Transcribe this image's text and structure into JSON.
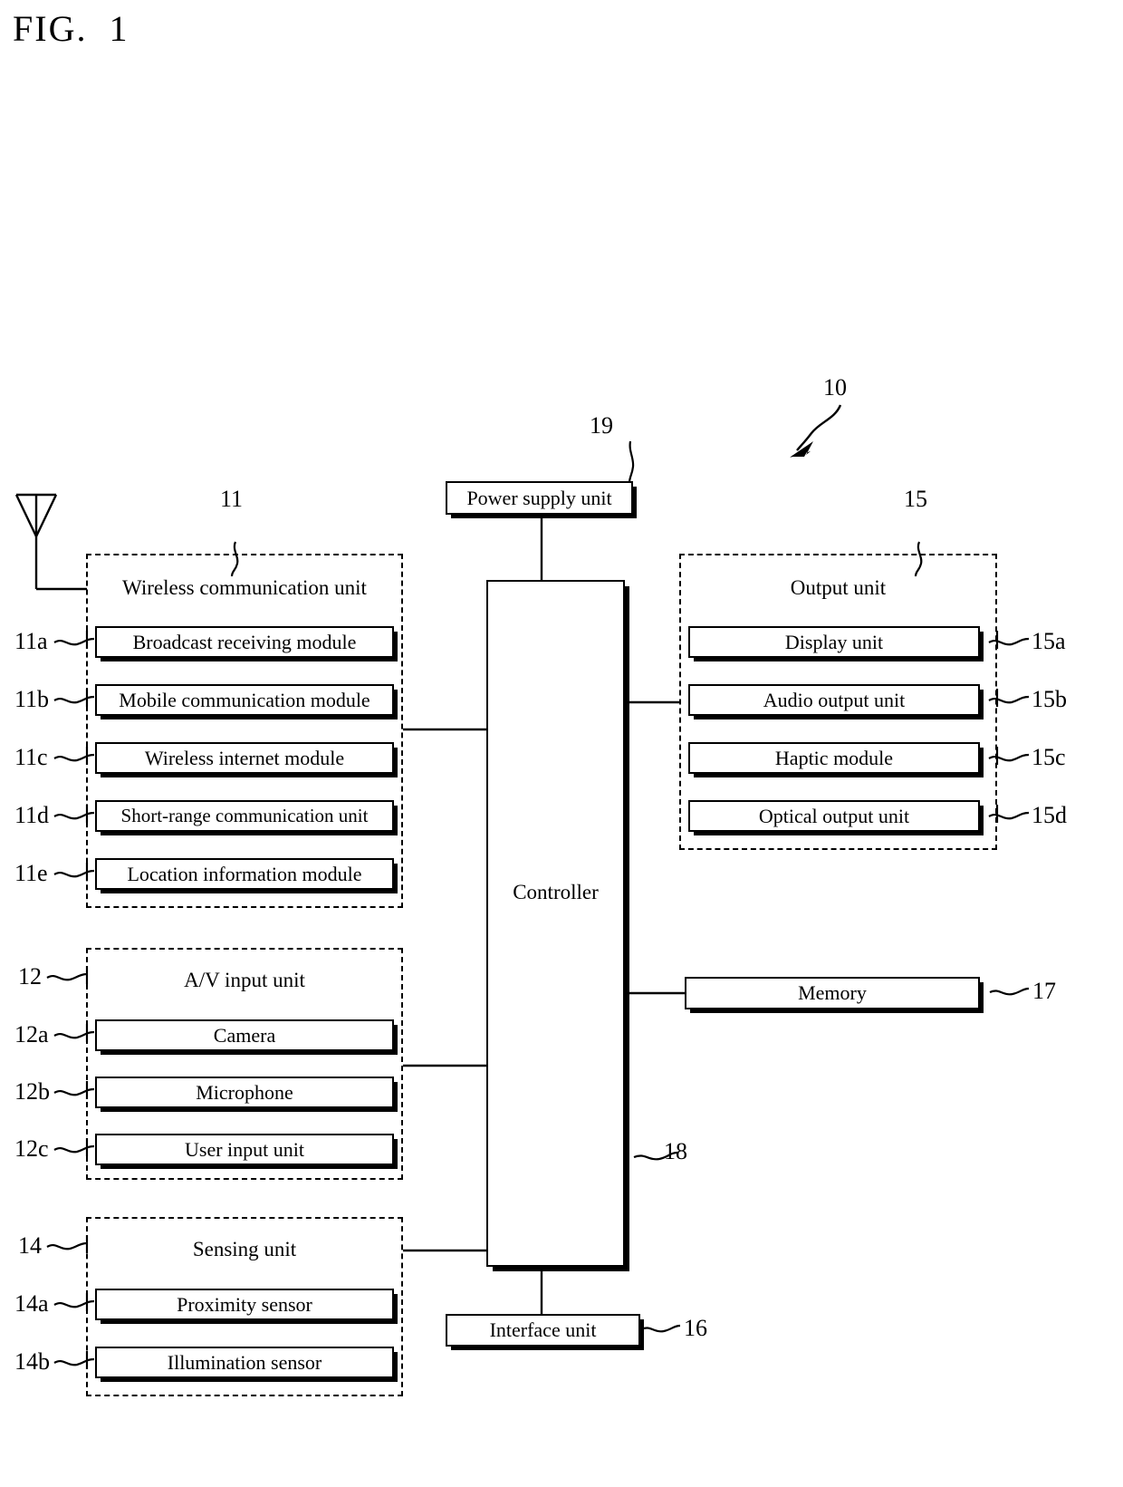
{
  "figure": {
    "title": "FIG.  1",
    "system_ref": "10"
  },
  "power_supply": {
    "label": "Power supply unit",
    "ref": "19"
  },
  "controller": {
    "label": "Controller",
    "ref": "18"
  },
  "wireless": {
    "ref": "11",
    "title": "Wireless communication unit",
    "modules": [
      {
        "ref": "11a",
        "label": "Broadcast receiving module"
      },
      {
        "ref": "11b",
        "label": "Mobile communication module"
      },
      {
        "ref": "11c",
        "label": "Wireless internet module"
      },
      {
        "ref": "11d",
        "label": "Short-range communication unit"
      },
      {
        "ref": "11e",
        "label": "Location information module"
      }
    ]
  },
  "av_input": {
    "ref": "12",
    "title": "A/V input unit",
    "modules": [
      {
        "ref": "12a",
        "label": "Camera"
      },
      {
        "ref": "12b",
        "label": "Microphone"
      },
      {
        "ref": "12c",
        "label": "User input unit"
      }
    ]
  },
  "sensing": {
    "ref": "14",
    "title": "Sensing unit",
    "modules": [
      {
        "ref": "14a",
        "label": "Proximity sensor"
      },
      {
        "ref": "14b",
        "label": "Illumination sensor"
      }
    ]
  },
  "output": {
    "ref": "15",
    "title": "Output unit",
    "modules": [
      {
        "ref": "15a",
        "label": "Display unit"
      },
      {
        "ref": "15b",
        "label": "Audio output unit"
      },
      {
        "ref": "15c",
        "label": "Haptic module"
      },
      {
        "ref": "15d",
        "label": "Optical output unit"
      }
    ]
  },
  "memory": {
    "label": "Memory",
    "ref": "17"
  },
  "interface": {
    "label": "Interface unit",
    "ref": "16"
  },
  "icons": {
    "antenna": "antenna-icon"
  },
  "colors": {
    "stroke": "#000000",
    "background": "#ffffff"
  }
}
